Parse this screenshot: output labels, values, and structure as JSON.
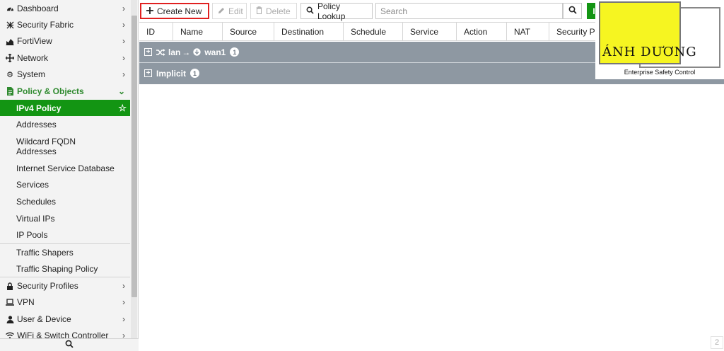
{
  "sidebar": {
    "items": [
      {
        "label": "Dashboard",
        "icon": "dashboard-icon"
      },
      {
        "label": "Security Fabric",
        "icon": "fabric-icon"
      },
      {
        "label": "FortiView",
        "icon": "chart-icon"
      },
      {
        "label": "Network",
        "icon": "network-icon"
      },
      {
        "label": "System",
        "icon": "gear-icon"
      },
      {
        "label": "Policy & Objects",
        "icon": "policy-icon"
      }
    ],
    "sub_items": [
      {
        "label": "IPv4 Policy"
      },
      {
        "label": "Addresses"
      },
      {
        "label": "Wildcard FQDN",
        "label2": "Addresses"
      },
      {
        "label": "Internet Service Database"
      },
      {
        "label": "Services"
      },
      {
        "label": "Schedules"
      },
      {
        "label": "Virtual IPs"
      },
      {
        "label": "IP Pools"
      },
      {
        "label": "Traffic Shapers"
      },
      {
        "label": "Traffic Shaping Policy"
      }
    ],
    "bottom_items": [
      {
        "label": "Security Profiles",
        "icon": "lock-icon"
      },
      {
        "label": "VPN",
        "icon": "laptop-icon"
      },
      {
        "label": "User & Device",
        "icon": "user-icon"
      },
      {
        "label": "WiFi & Switch Controller",
        "icon": "wifi-icon"
      }
    ]
  },
  "toolbar": {
    "create_label": "Create New",
    "edit_label": "Edit",
    "delete_label": "Delete",
    "lookup_label": "Policy Lookup",
    "search_placeholder": "Search",
    "green_button_label": "I"
  },
  "table": {
    "columns": [
      "ID",
      "Name",
      "Source",
      "Destination",
      "Schedule",
      "Service",
      "Action",
      "NAT",
      "Security Pr"
    ],
    "groups": [
      {
        "from": "lan",
        "arrow": "→",
        "to": "wan1",
        "count": "1"
      },
      {
        "label": "Implicit",
        "count": "1"
      }
    ]
  },
  "logo": {
    "title": "ÁNH DƯƠNG",
    "subtitle": "Enterprise Safety Control"
  },
  "pagination": {
    "page": "2"
  },
  "colors": {
    "accent": "#139513",
    "group_bg": "#8e98a2",
    "highlight": "#e02020",
    "logo_yellow": "#f6f521"
  }
}
